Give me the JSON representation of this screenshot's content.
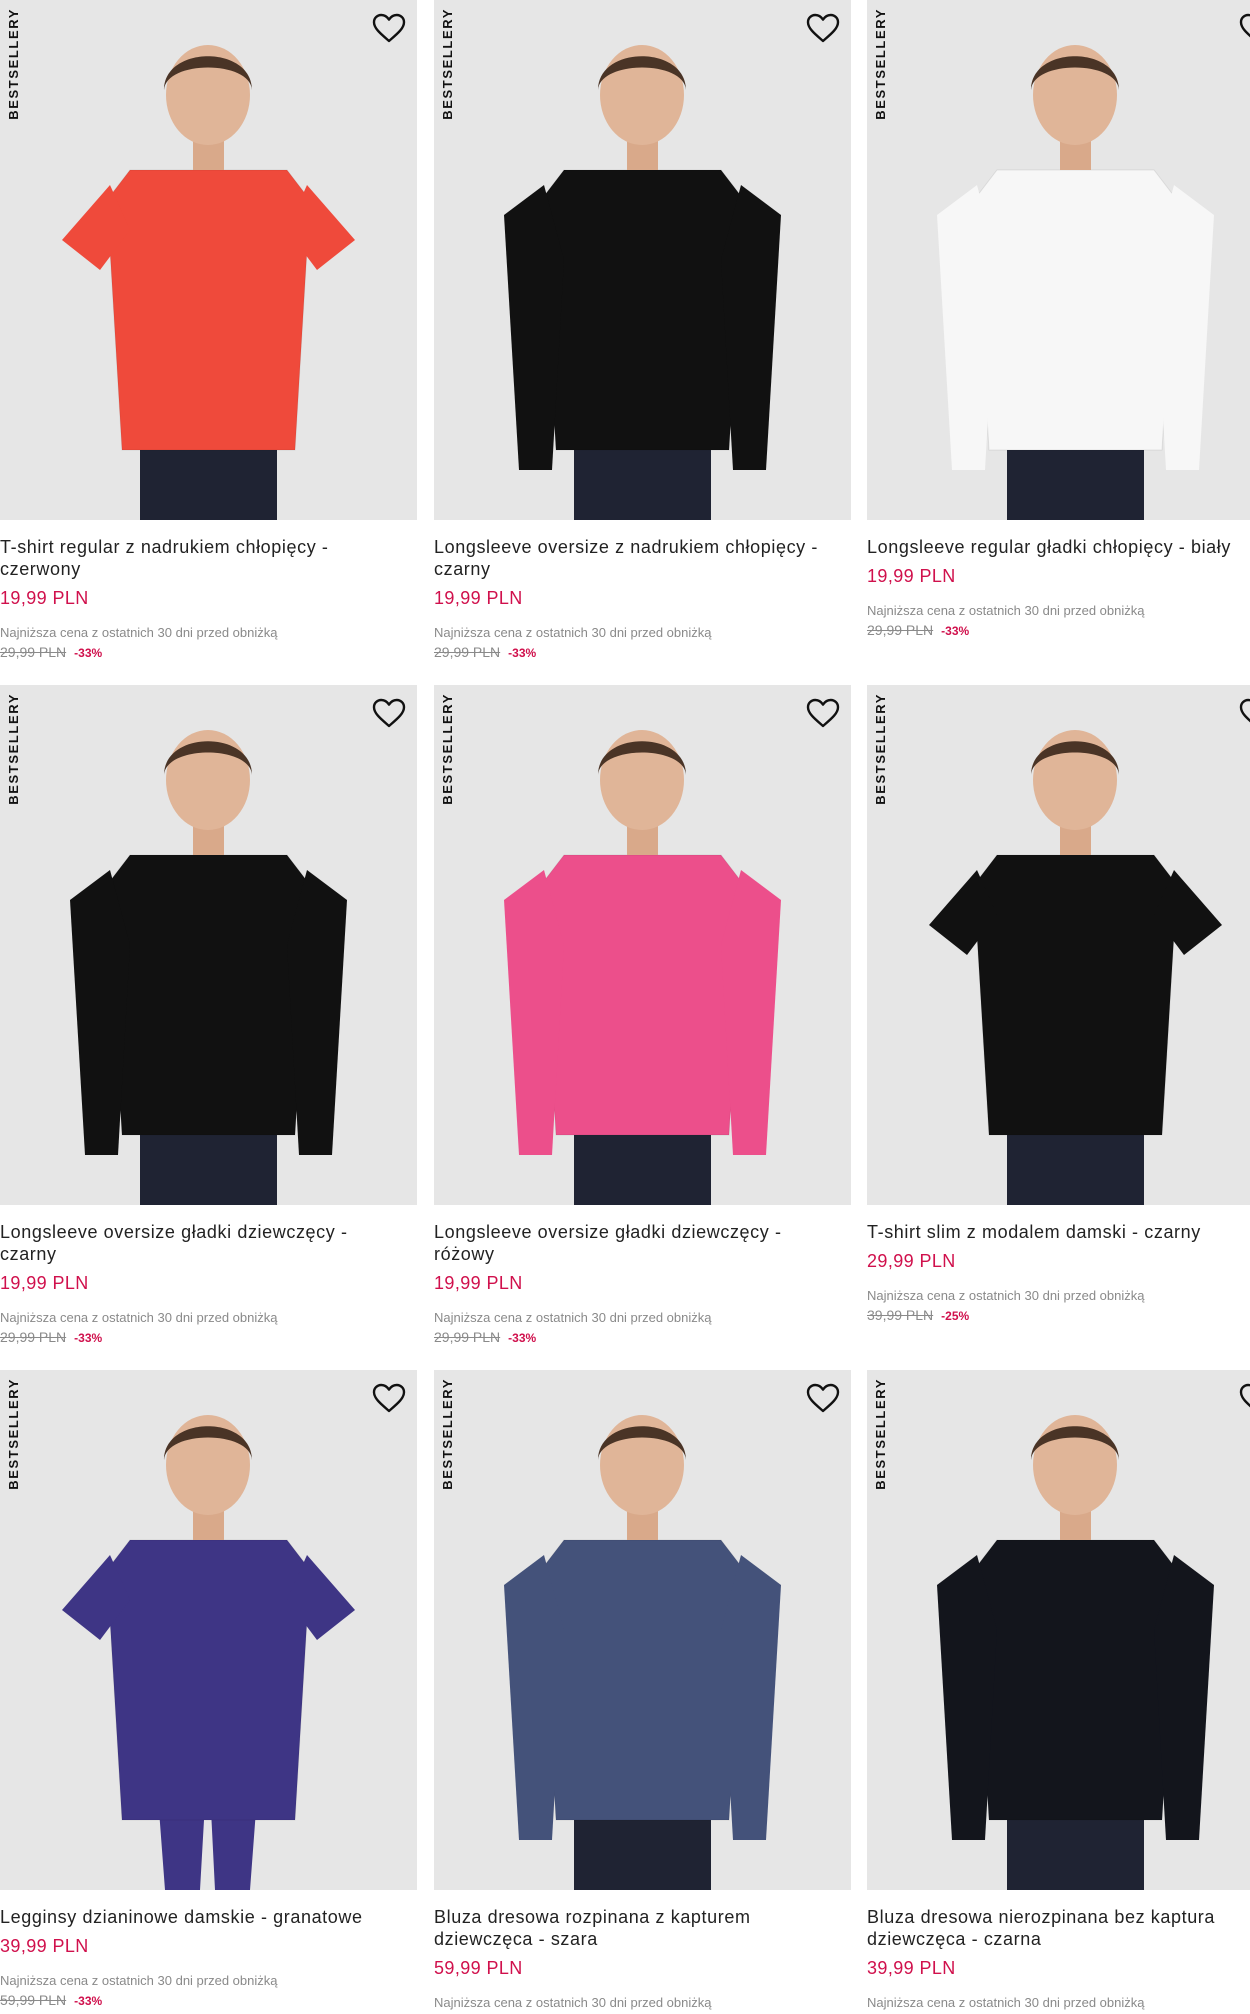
{
  "badge": "BESTSELLERY",
  "colors": {
    "price": "#d0104c",
    "muted": "#8a8a8a",
    "background": "#e6e6e6"
  },
  "icons": {
    "favorite": "heart-outline-icon"
  },
  "products": [
    {
      "title": "T-shirt regular z nadrukiem chłopięcy - czerwony",
      "price": "19,99 PLN",
      "lowest_label": "Najniższa cena z ostatnich 30 dni przed obniżką",
      "old_price": "29,99 PLN",
      "discount": "-33%",
      "garment_color": "#ef4a3b"
    },
    {
      "title": "Longsleeve oversize z nadrukiem chłopięcy - czarny",
      "price": "19,99 PLN",
      "lowest_label": "Najniższa cena z ostatnich 30 dni przed obniżką",
      "old_price": "29,99 PLN",
      "discount": "-33%",
      "garment_color": "#111111"
    },
    {
      "title": "Longsleeve regular gładki chłopięcy - biały",
      "price": "19,99 PLN",
      "lowest_label": "Najniższa cena z ostatnich 30 dni przed obniżką",
      "old_price": "29,99 PLN",
      "discount": "-33%",
      "garment_color": "#f7f7f7"
    },
    {
      "title": "Longsleeve oversize gładki dziewczęcy - czarny",
      "price": "19,99 PLN",
      "lowest_label": "Najniższa cena z ostatnich 30 dni przed obniżką",
      "old_price": "29,99 PLN",
      "discount": "-33%",
      "garment_color": "#111111"
    },
    {
      "title": "Longsleeve oversize gładki dziewczęcy - różowy",
      "price": "19,99 PLN",
      "lowest_label": "Najniższa cena z ostatnich 30 dni przed obniżką",
      "old_price": "29,99 PLN",
      "discount": "-33%",
      "garment_color": "#ec4f8b"
    },
    {
      "title": "T-shirt slim z modalem damski - czarny",
      "price": "29,99 PLN",
      "lowest_label": "Najniższa cena z ostatnich 30 dni przed obniżką",
      "old_price": "39,99 PLN",
      "discount": "-25%",
      "garment_color": "#111111"
    },
    {
      "title": "Legginsy dzianinowe damskie - granatowe",
      "price": "39,99 PLN",
      "lowest_label": "Najniższa cena z ostatnich 30 dni przed obniżką",
      "old_price": "59,99 PLN",
      "discount": "-33%",
      "garment_color": "#3e3585"
    },
    {
      "title": "Bluza dresowa rozpinana z kapturem dziewczęca - szara",
      "price": "59,99 PLN",
      "lowest_label": "Najniższa cena z ostatnich 30 dni przed obniżką",
      "old_price": "",
      "discount": "",
      "garment_color": "#44527a"
    },
    {
      "title": "Bluza dresowa nierozpinana bez kaptura dziewczęca - czarna",
      "price": "39,99 PLN",
      "lowest_label": "Najniższa cena z ostatnich 30 dni przed obniżką",
      "old_price": "",
      "discount": "",
      "garment_color": "#13151c"
    }
  ]
}
